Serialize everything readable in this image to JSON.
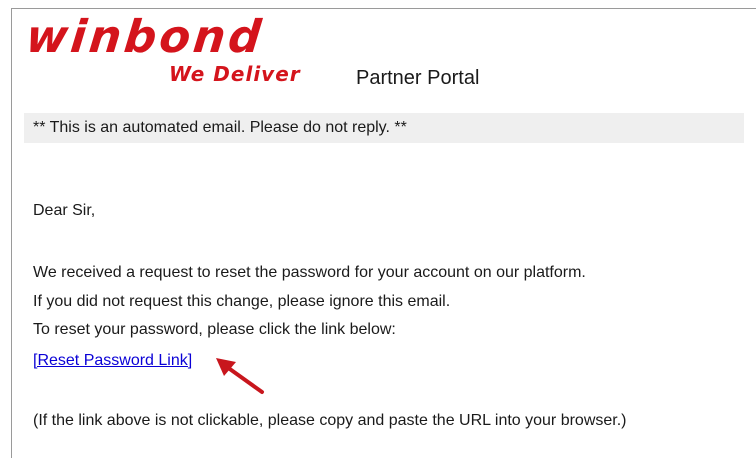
{
  "brand": {
    "logo_text": "winbond",
    "tagline": "We Deliver",
    "portal_label": "Partner Portal",
    "brand_color": "#d4141c"
  },
  "email": {
    "notice": "** This is an automated email. Please do not reply. **",
    "greeting": "Dear Sir,",
    "lines": [
      "We received a request to reset the password for your account on our platform.",
      "If you did not request this change, please ignore this email.",
      "To reset your password, please click the link below:"
    ],
    "reset_link_label": "[Reset Password Link]",
    "link_color": "#0a00d6",
    "footer_note": "(If the link above is not clickable, please copy and paste the URL into your browser.)"
  },
  "annotation": {
    "arrow_icon": "red-arrow-icon",
    "arrow_color": "#c8161d"
  }
}
